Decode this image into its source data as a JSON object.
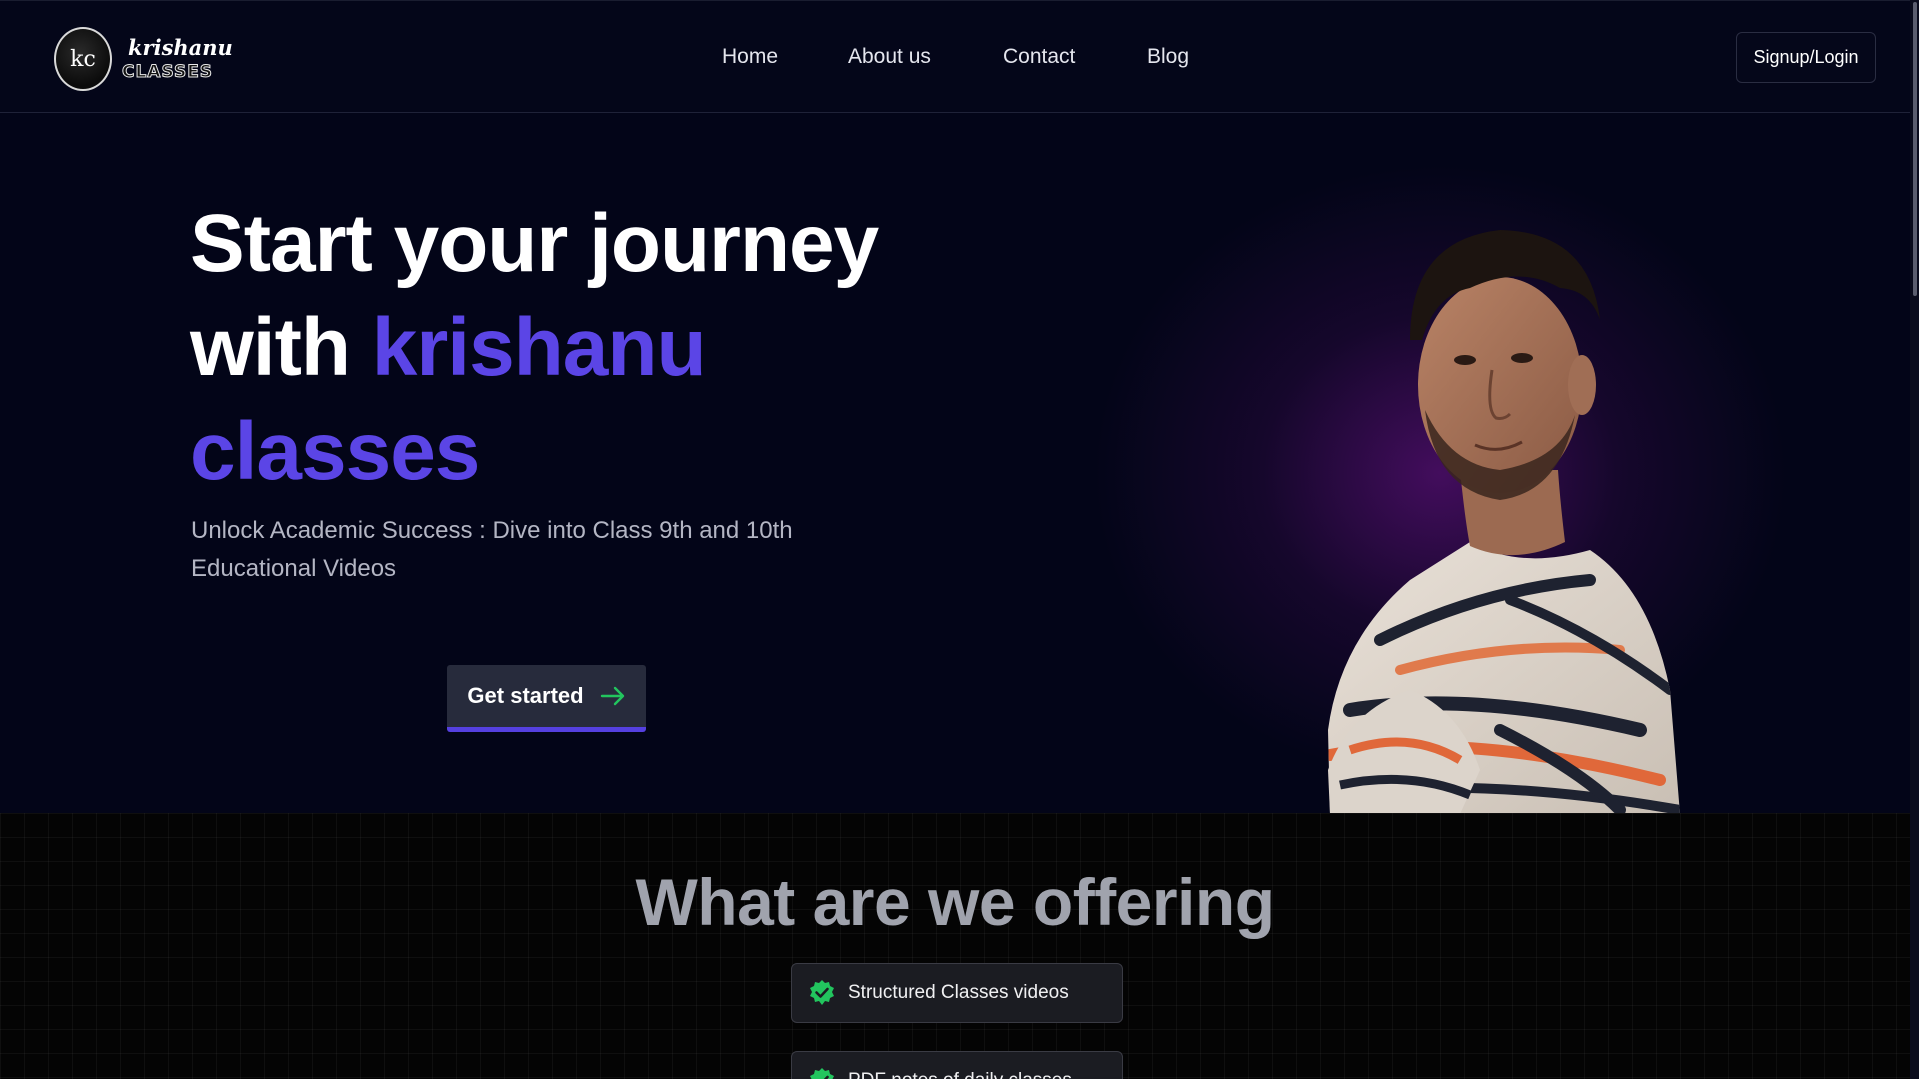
{
  "brand": {
    "logo_mark": "kc",
    "name_line1": "krishanu",
    "name_line2": "CLASSES"
  },
  "nav": {
    "items": [
      {
        "label": "Home"
      },
      {
        "label": "About us"
      },
      {
        "label": "Contact"
      },
      {
        "label": "Blog"
      }
    ],
    "signup_label": "Signup/Login"
  },
  "hero": {
    "title_line1": "Start your journey",
    "title_with": "with",
    "title_accent_1": "krishanu",
    "title_accent_2": "classes",
    "subtitle": "Unlock Academic Success : Dive into Class 9th and 10th Educational Videos",
    "cta_label": "Get started",
    "cta_icon": "arrow-right-icon"
  },
  "offering": {
    "title": "What are we offering",
    "items": [
      {
        "label": "Structured Classes videos",
        "icon": "verified-badge-icon"
      },
      {
        "label": "PDF notes of daily classes",
        "icon": "verified-badge-icon"
      }
    ]
  },
  "colors": {
    "accent": "#5b45e6",
    "background": "#030518",
    "badge_green": "#22c55e"
  }
}
